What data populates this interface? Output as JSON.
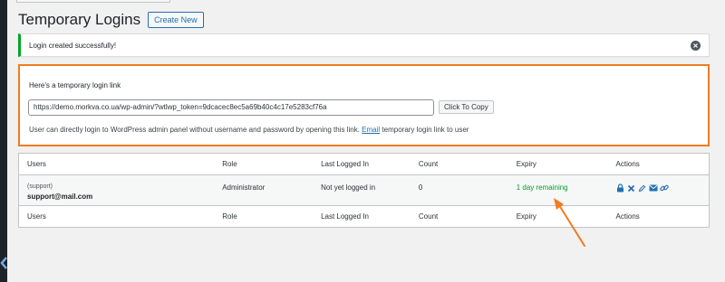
{
  "header": {
    "title": "Temporary Logins",
    "create_button": "Create New"
  },
  "notice": {
    "text": "Login created successfully!"
  },
  "link_box": {
    "heading": "Here's a temporary login link",
    "url_value": "https://demo.morkva.co.ua/wp-admin/?wtlwp_token=9dcacec8ec5a69b40c4c17e5283cf76a",
    "copy_button": "Click To Copy",
    "help_before": "User can directly login to WordPress admin panel without username and password by opening this link.",
    "help_link": "Email",
    "help_after": "temporary login link to user"
  },
  "table": {
    "columns": [
      "Users",
      "Role",
      "Last Logged In",
      "Count",
      "Expiry",
      "Actions"
    ],
    "rows": [
      {
        "user_sub": "(support)",
        "user_email": "support@mail.com",
        "role": "Administrator",
        "last_logged_in": "Not yet logged in",
        "count": "0",
        "expiry": "1 day remaining"
      }
    ]
  },
  "colors": {
    "accent": "#2271b1",
    "highlight_border": "#f07b20",
    "success": "#00a32a"
  },
  "icons": [
    "lock-icon",
    "delete-icon",
    "edit-icon",
    "email-icon",
    "link-icon"
  ]
}
